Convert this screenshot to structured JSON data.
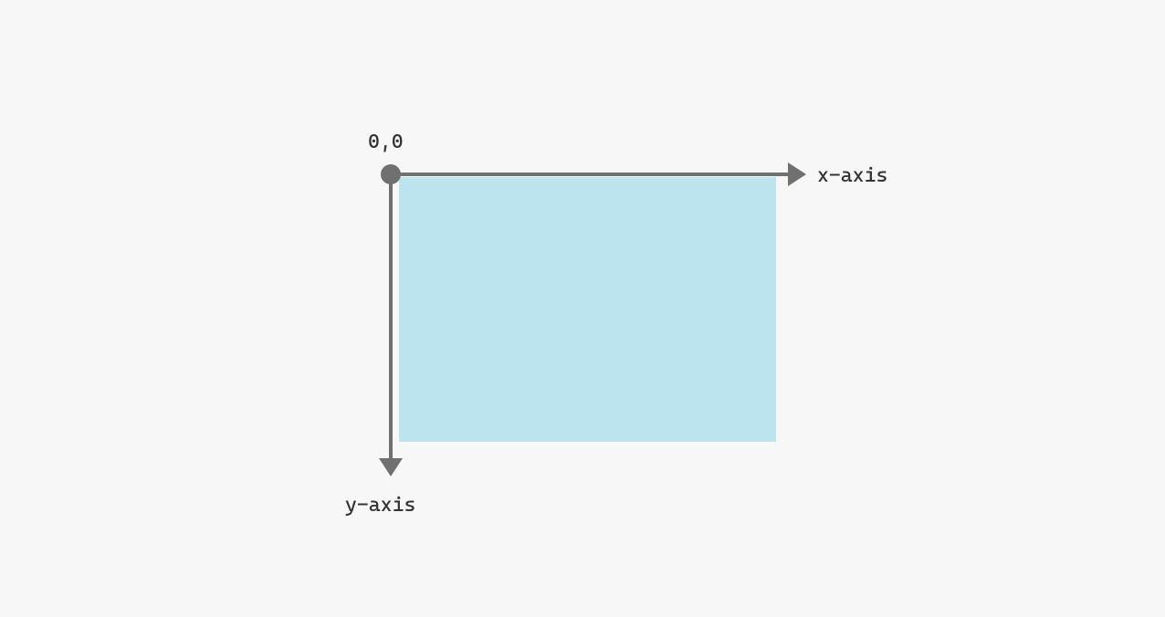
{
  "diagram": {
    "origin_label": "0,0",
    "x_axis_label": "x-axis",
    "y_axis_label": "y-axis",
    "axis_color": "#707070",
    "canvas_color": "#bce4ef",
    "bg_color": "#f7f7f7"
  }
}
